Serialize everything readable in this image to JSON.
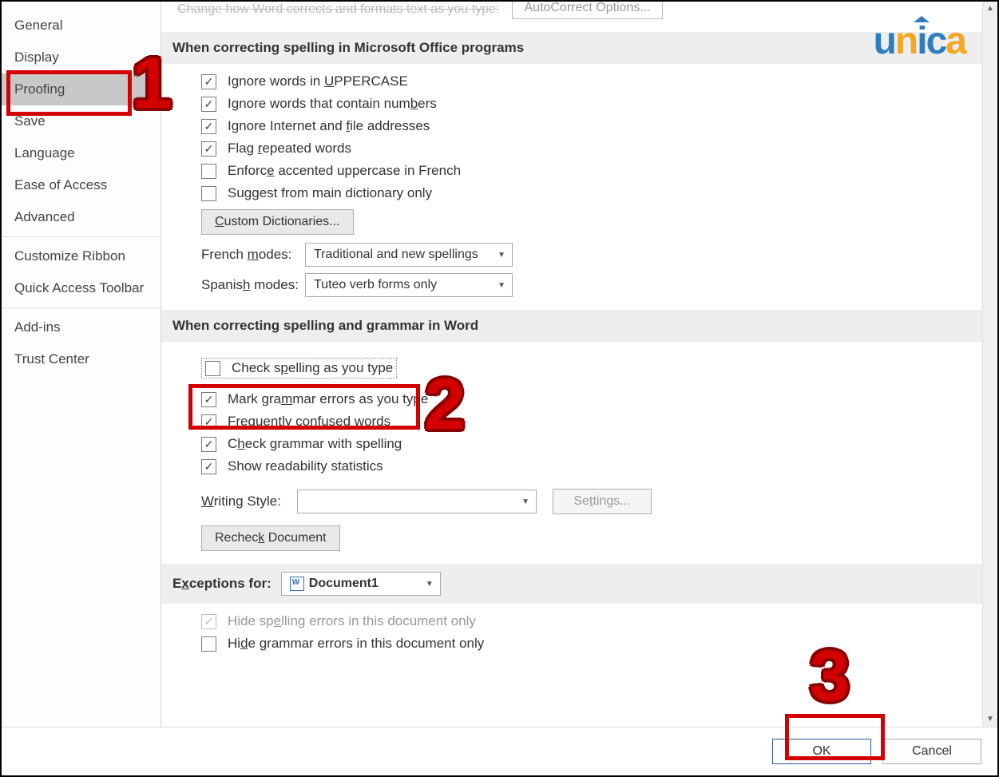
{
  "sidebar": {
    "items": [
      {
        "label": "General"
      },
      {
        "label": "Display"
      },
      {
        "label": "Proofing"
      },
      {
        "label": "Save"
      },
      {
        "label": "Language"
      },
      {
        "label": "Ease of Access"
      },
      {
        "label": "Advanced"
      },
      {
        "label": "Customize Ribbon"
      },
      {
        "label": "Quick Access Toolbar"
      },
      {
        "label": "Add-ins"
      },
      {
        "label": "Trust Center"
      }
    ],
    "selected_index": 2
  },
  "truncated_heading": "Change how Word corrects and formats text as you type:",
  "autocorrect_button": "AutoCorrect Options...",
  "section1": {
    "title": "When correcting spelling in Microsoft Office programs",
    "opt_uppercase": "Ignore words in UPPERCASE",
    "opt_numbers": "Ignore words that contain numbers",
    "opt_internet": "Ignore Internet and file addresses",
    "opt_repeated": "Flag repeated words",
    "opt_french": "Enforce accented uppercase in French",
    "opt_maindict": "Suggest from main dictionary only",
    "custom_dict_btn": "Custom Dictionaries...",
    "french_label": "French modes:",
    "french_value": "Traditional and new spellings",
    "spanish_label": "Spanish modes:",
    "spanish_value": "Tuteo verb forms only"
  },
  "section2": {
    "title": "When correcting spelling and grammar in Word",
    "opt_check_spelling": "Check spelling as you type",
    "opt_mark_grammar": "Mark grammar errors as you type",
    "opt_confused": "Frequently confused words",
    "opt_check_grammar": "Check grammar with spelling",
    "opt_readability": "Show readability statistics",
    "writing_style_label": "Writing Style:",
    "writing_style_value": "",
    "settings_btn": "Settings...",
    "recheck_btn": "Recheck Document"
  },
  "section3": {
    "title": "Exceptions for:",
    "doc_value": "Document1",
    "opt_hide_spelling": "Hide spelling errors in this document only",
    "opt_hide_grammar": "Hide grammar errors in this document only"
  },
  "buttons": {
    "ok": "OK",
    "cancel": "Cancel"
  },
  "logo": {
    "text": "unica"
  },
  "annotations": {
    "n1": "1",
    "n2": "2",
    "n3": "3"
  }
}
